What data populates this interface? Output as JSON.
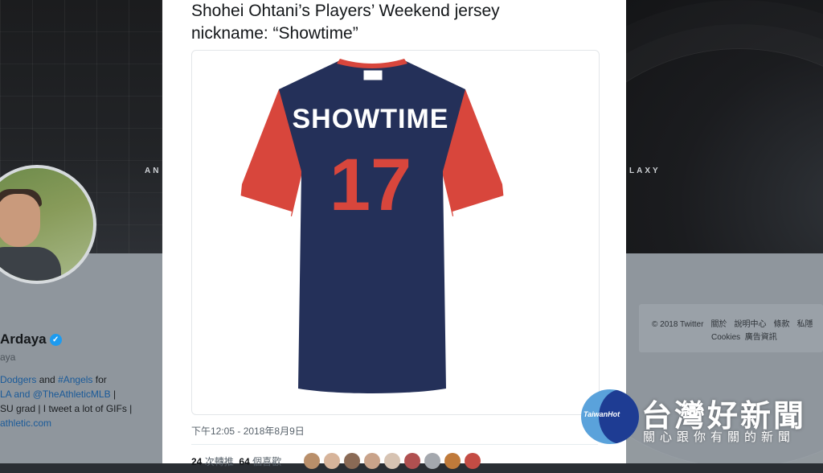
{
  "tweet": {
    "text_line1": "Shohei Ohtani’s Players’ Weekend jersey",
    "text_line2": "nickname: “Showtime”",
    "timestamp": "下午12:05 - 2018年8月9日",
    "retweets_count": "24",
    "retweets_label": "次轉推",
    "likes_count": "64",
    "likes_label": "個喜歡"
  },
  "jersey": {
    "nickname": "SHOWTIME",
    "number": "17",
    "body_color": "#243059",
    "sleeve_color": "#d8463c",
    "number_color": "#d8463c"
  },
  "profile": {
    "name": "Ardaya",
    "handle": "aya",
    "bio_line1_a": "Dodgers",
    "bio_line1_b": " and ",
    "bio_line1_c": "#Angels",
    "bio_line1_d": " for",
    "bio_line2_a": "LA and ",
    "bio_line2_b": "@TheAthleticMLB",
    "bio_line2_c": " |",
    "bio_line3": "SU grad | I tweet a lot of GIFs |",
    "bio_line4": "athletic.com"
  },
  "banner": {
    "left_text": "AN",
    "right_text": "LAXY"
  },
  "footer": {
    "copyright": "© 2018 Twitter",
    "about": "關於",
    "help": "說明中心",
    "terms": "條款",
    "privacy": "私隱",
    "cookies": "Cookies",
    "ads": "廣告資訊"
  },
  "watermark": {
    "small": "TaiwanHot",
    "title": "台灣好新聞",
    "subtitle": "關心跟你有關的新聞"
  },
  "icons": [
    "verified-badge-icon"
  ]
}
